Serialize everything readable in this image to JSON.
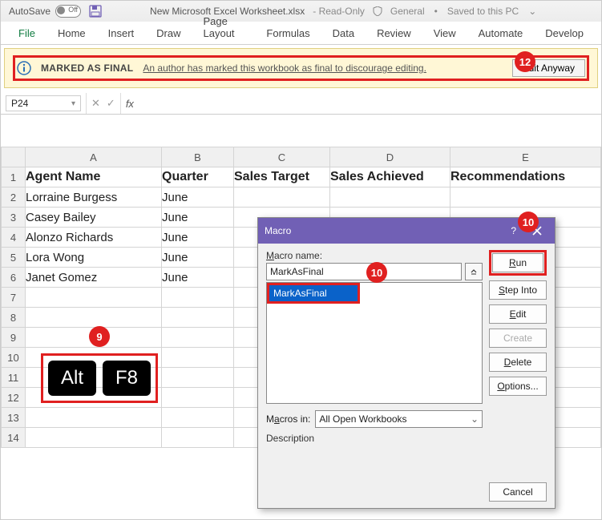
{
  "title": {
    "autosave_label": "AutoSave",
    "toggle_state": "Off",
    "filename": "New Microsoft Excel Worksheet.xlsx",
    "readonly": "Read-Only",
    "sensitivity": "General",
    "saved_state": "Saved to this PC"
  },
  "ribbon": {
    "tabs": [
      "File",
      "Home",
      "Insert",
      "Draw",
      "Page Layout",
      "Formulas",
      "Data",
      "Review",
      "View",
      "Automate",
      "Develop"
    ]
  },
  "messagebar": {
    "title": "MARKED AS FINAL",
    "text": "An author has marked this workbook as final to discourage editing.",
    "button": "Edit Anyway"
  },
  "formula_bar": {
    "namebox": "P24",
    "fx": "fx"
  },
  "grid": {
    "columns": [
      "A",
      "B",
      "C",
      "D",
      "E"
    ],
    "rows": [
      "1",
      "2",
      "3",
      "4",
      "5",
      "6",
      "7",
      "8",
      "9",
      "10",
      "11",
      "12",
      "13",
      "14"
    ],
    "headers": [
      "Agent Name",
      "Quarter",
      "Sales Target",
      "Sales Achieved",
      "Recommendations"
    ],
    "data": [
      [
        "Lorraine Burgess",
        "June",
        "",
        "",
        ""
      ],
      [
        "Casey Bailey",
        "June",
        "",
        "",
        ""
      ],
      [
        "Alonzo Richards",
        "June",
        "",
        "",
        ""
      ],
      [
        "Lora Wong",
        "June",
        "",
        "",
        ""
      ],
      [
        "Janet Gomez",
        "June",
        "",
        "",
        ""
      ]
    ]
  },
  "keys": {
    "k1": "Alt",
    "k2": "F8"
  },
  "dialog": {
    "title": "Macro",
    "macro_name_label": "Macro name:",
    "macro_name_value": "MarkAsFinal",
    "list_item": "MarkAsFinal",
    "macros_in_label": "Macros in:",
    "macros_in_value": "All Open Workbooks",
    "description_label": "Description",
    "buttons": {
      "run": "Run",
      "step": "Step Into",
      "edit": "Edit",
      "create": "Create",
      "delete": "Delete",
      "options": "Options...",
      "cancel": "Cancel"
    }
  },
  "callouts": {
    "c9": "9",
    "c10a": "10",
    "c10b": "10",
    "c12": "12"
  }
}
